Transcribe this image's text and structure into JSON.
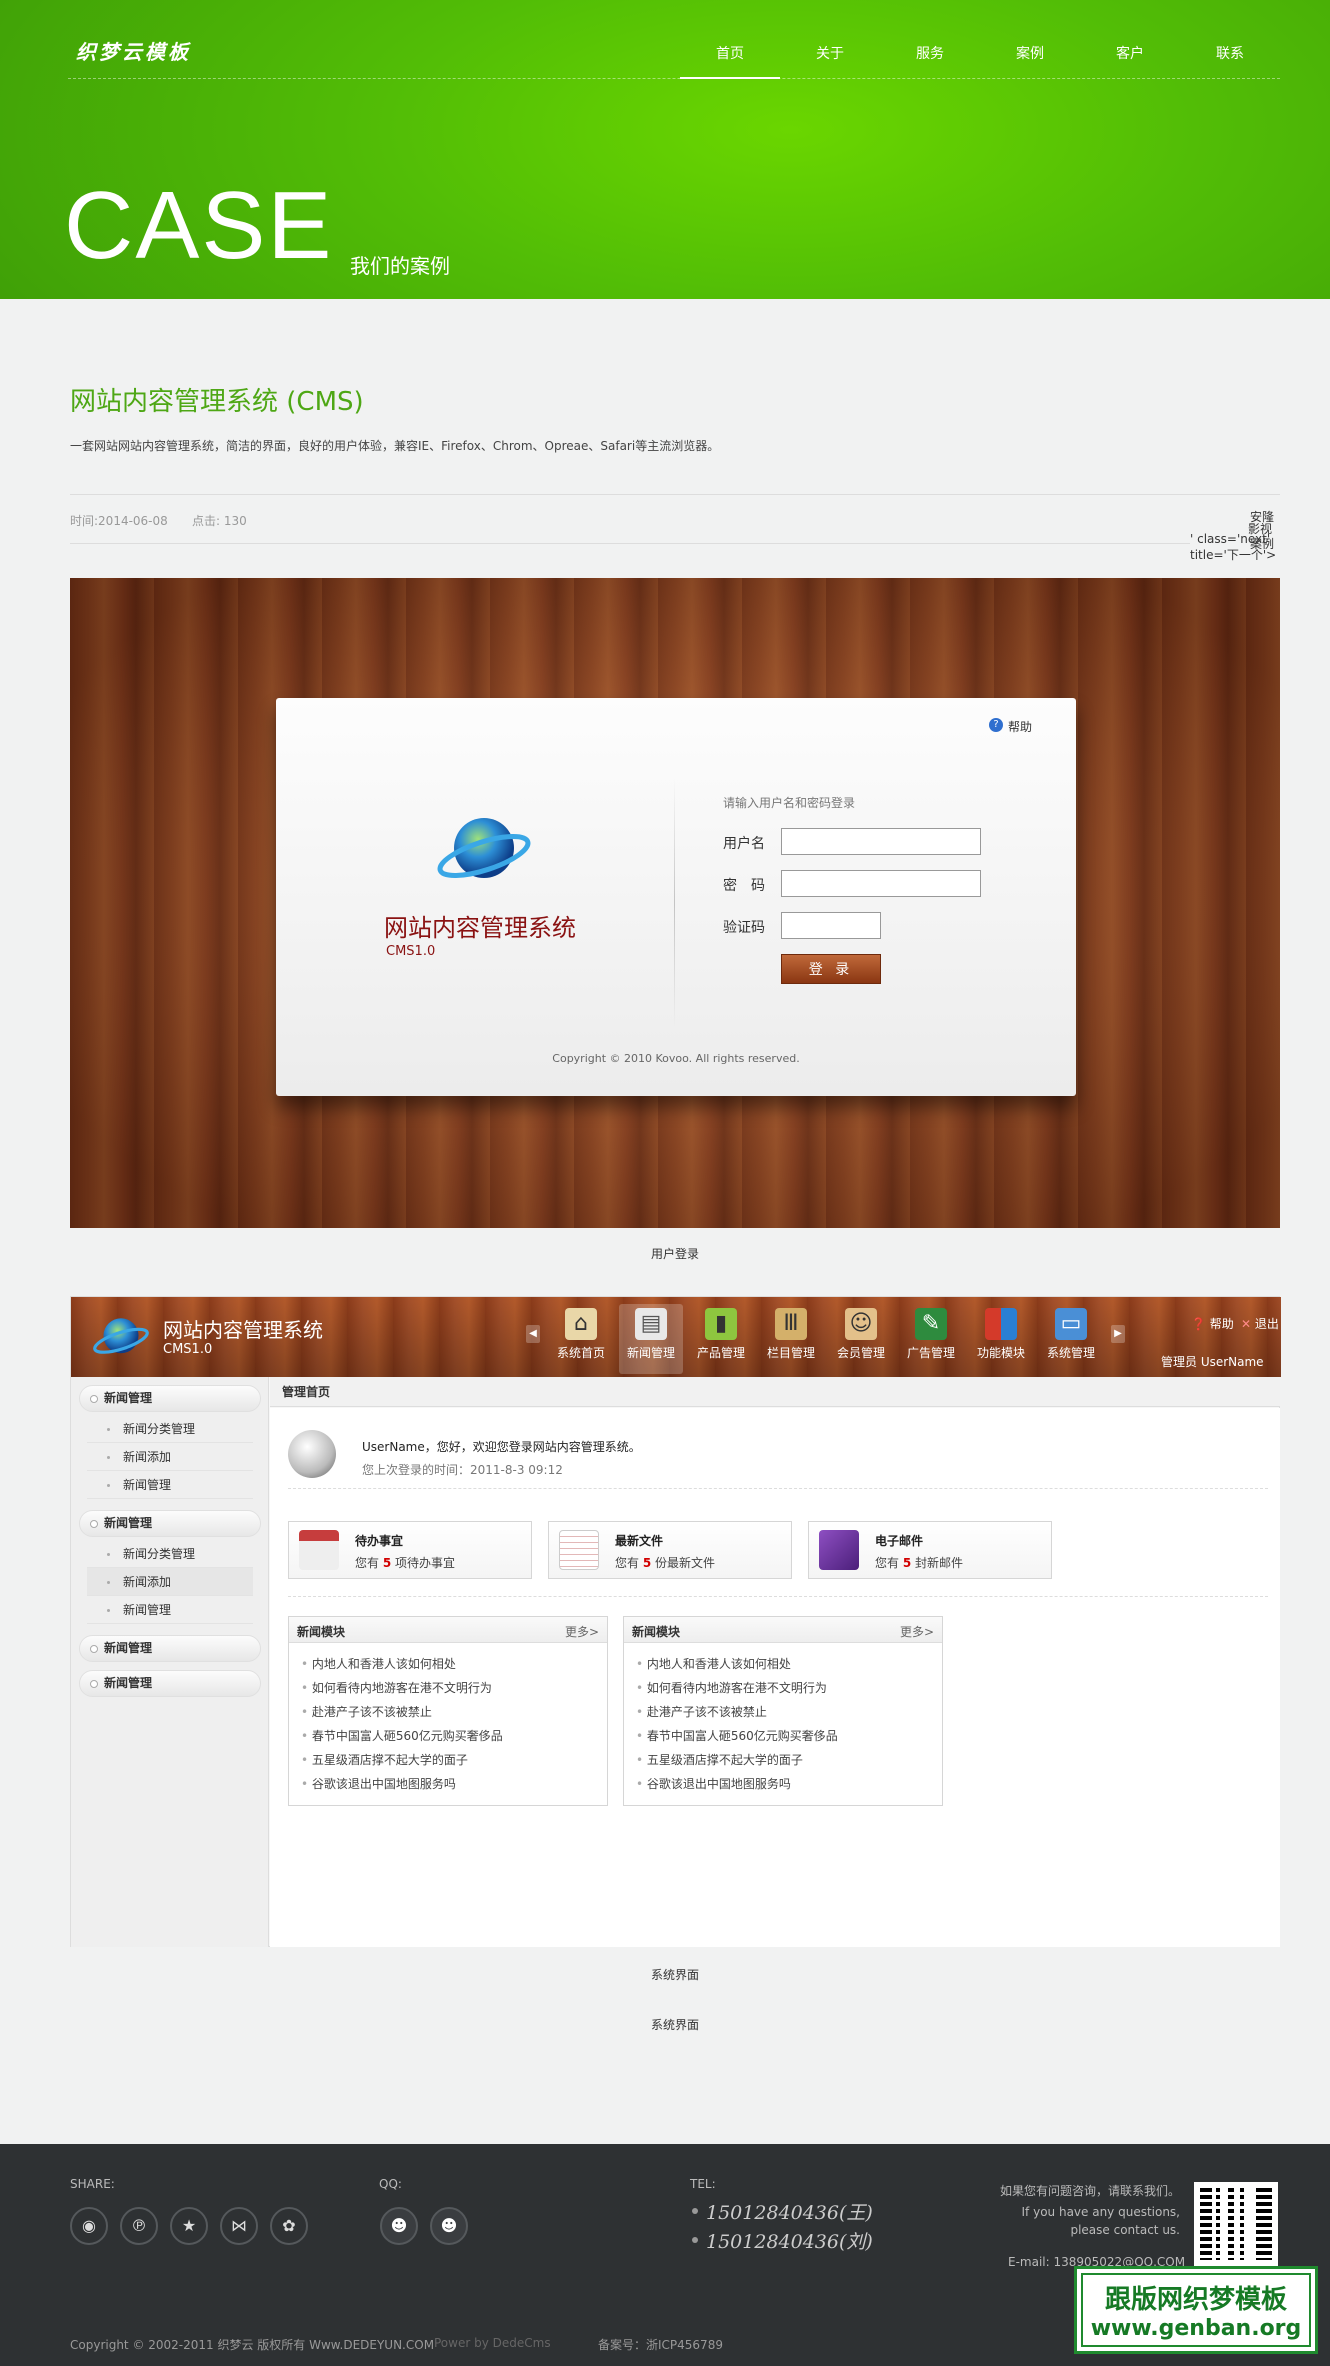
{
  "header": {
    "logo": "织梦云模板",
    "nav": [
      "首页",
      "关于",
      "服务",
      "案例",
      "客户",
      "联系"
    ],
    "active_nav": "首页",
    "banner_title": "CASE",
    "banner_subtitle": "我们的案例"
  },
  "article": {
    "title": "网站内容管理系统 (CMS)",
    "description": "一套网站网站内容管理系统，简洁的界面，良好的用户体验，兼容IE、Firefox、Chrom、Opreae、Safari等主流浏览器。",
    "time": "时间:2014-06-08",
    "clicks": "点击: 130",
    "prevnext_fragments": [
      "安隆",
      "影视",
      "' class='next'",
      "案例",
      "title='下一个'>"
    ]
  },
  "screenshot1": {
    "help": "帮助",
    "system_title": "网站内容管理系统",
    "version": "CMS1.0",
    "prompt": "请输入用户名和密码登录",
    "username_label": "用户名",
    "password_label": "密　码",
    "captcha_label": "验证码",
    "login_button": "登 录",
    "copyright": "Copyright © 2010 Kovoo. All rights reserved.",
    "caption": "用户登录"
  },
  "screenshot2": {
    "system_title": "网站内容管理系统",
    "version": "CMS1.0",
    "toolbar": [
      "系统首页",
      "新闻管理",
      "产品管理",
      "栏目管理",
      "会员管理",
      "广告管理",
      "功能模块",
      "系统管理"
    ],
    "active_tool": "新闻管理",
    "help": "帮助",
    "logout": "退出",
    "user_label": "管理员 UserName",
    "sidebar": {
      "group1": {
        "title": "新闻管理",
        "items": [
          "新闻分类管理",
          "新闻添加",
          "新闻管理"
        ]
      },
      "group2": {
        "title": "新闻管理",
        "items": [
          "新闻分类管理",
          "新闻添加",
          "新闻管理"
        ]
      },
      "group3": {
        "title": "新闻管理"
      },
      "group4": {
        "title": "新闻管理"
      }
    },
    "breadcrumb": "管理首页",
    "welcome": "UserName，您好，欢迎您登录网站内容管理系统。",
    "last_login": "您上次登录的时间：2011-8-3 09:12",
    "cards": [
      {
        "title": "待办事宜",
        "pre": "您有 ",
        "count": "5",
        "post": " 项待办事宜"
      },
      {
        "title": "最新文件",
        "pre": "您有 ",
        "count": "5",
        "post": " 份最新文件"
      },
      {
        "title": "电子邮件",
        "pre": "您有 ",
        "count": "5",
        "post": " 封新邮件"
      }
    ],
    "news_panels": [
      {
        "title": "新闻模块",
        "more": "更多>",
        "items": [
          "内地人和香港人该如何相处",
          "如何看待内地游客在港不文明行为",
          "赴港产子该不该被禁止",
          "春节中国富人砸560亿元购买奢侈品",
          "五星级酒店撑不起大学的面子",
          "谷歌该退出中国地图服务吗"
        ]
      },
      {
        "title": "新闻模块",
        "more": "更多>",
        "items": [
          "内地人和香港人该如何相处",
          "如何看待内地游客在港不文明行为",
          "赴港产子该不该被禁止",
          "春节中国富人砸560亿元购买奢侈品",
          "五星级酒店撑不起大学的面子",
          "谷歌该退出中国地图服务吗"
        ]
      }
    ],
    "caption": "系统界面",
    "caption2": "系统界面"
  },
  "footer": {
    "share_label": "SHARE:",
    "qq_label": "QQ:",
    "tel_label": "TEL:",
    "tels": [
      "15012840436(王)",
      "15012840436(刘)"
    ],
    "contact_cn": "如果您有问题咨询，请联系我们。",
    "contact_en_1": "If you have any questions,",
    "contact_en_2": "please contact us.",
    "email": "E-mail: 138905022@QQ.COM",
    "copyright": "Copyright © 2002-2011 织梦云 版权所有 Www.DEDEYUN.COM",
    "power": "Power by DedeCms",
    "icp": "备案号：浙ICP456789",
    "share_icons": [
      "weibo-icon",
      "tencent-weibo-icon",
      "star-icon",
      "renren-icon",
      "baidu-icon"
    ],
    "qq_icons": [
      "qq-icon",
      "qq-icon"
    ]
  },
  "watermark": {
    "line1": "跟版网织梦模板",
    "line2": "www.genban.org"
  },
  "colors": {
    "brand_green": "#4ea715",
    "footer_bg": "#2e3133",
    "wood": "#a14a22"
  }
}
